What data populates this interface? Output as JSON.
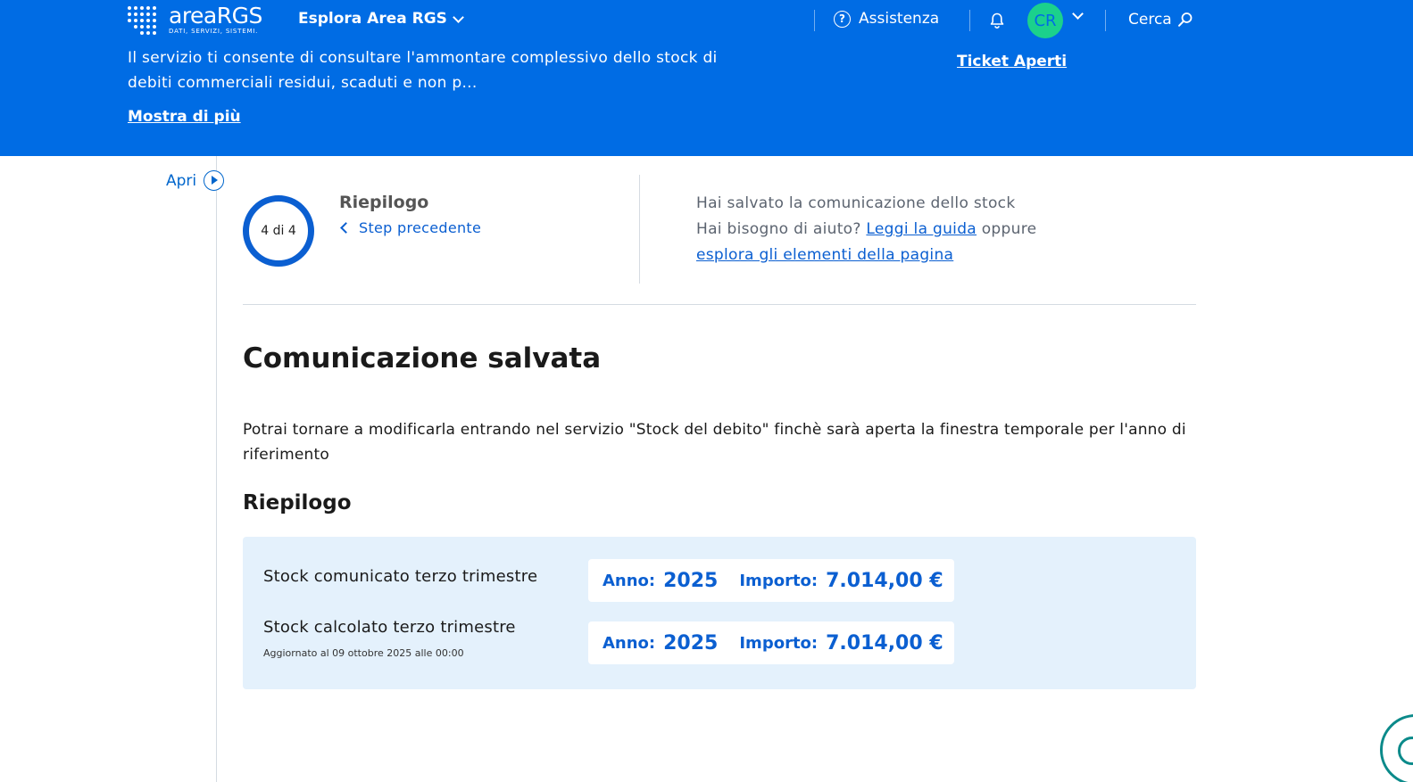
{
  "header": {
    "logo_name": "areaRGS",
    "logo_tagline": "DATI, SERVIZI, SISTEMI.",
    "explore_label": "Esplora Area RGS",
    "assist_label": "Assistenza",
    "avatar_initials": "CR",
    "search_label": "Cerca",
    "description": "Il servizio ti consente di consultare l'ammontare complessivo dello stock di debiti commerciali residui, scaduti e non p...",
    "show_more": "Mostra di più",
    "tickets_link": "Ticket Aperti"
  },
  "sidebar": {
    "toggle_label": "Apri"
  },
  "stepper": {
    "progress": "4 di 4",
    "title": "Riepilogo",
    "prev_label": "Step precedente"
  },
  "help": {
    "saved_msg": "Hai salvato la comunicazione dello stock",
    "need_help": "Hai bisogno di aiuto?",
    "guide_link": "Leggi la guida",
    "or": "oppure",
    "explore_link": "esplora gli elementi della pagina"
  },
  "main": {
    "title": "Comunicazione salvata",
    "intro": "Potrai tornare a modificarla entrando nel servizio \"Stock del debito\" finchè sarà aperta la finestra temporale per l'anno di riferimento",
    "summary_title": "Riepilogo",
    "rows": [
      {
        "label": "Stock comunicato terzo trimestre",
        "year_key": "Anno:",
        "year": "2025",
        "amount_key": "Importo:",
        "amount": "7.014,00 €"
      },
      {
        "label": "Stock calcolato terzo trimestre",
        "note": "Aggiornato al 09 ottobre 2025 alle 00:00",
        "year_key": "Anno:",
        "year": "2025",
        "amount_key": "Importo:",
        "amount": "7.014,00 €"
      }
    ]
  },
  "colors": {
    "primary": "#006ce4",
    "accent": "#0b5fd1",
    "avatar": "#1bd18c",
    "summary_bg": "#e4f1fc"
  }
}
